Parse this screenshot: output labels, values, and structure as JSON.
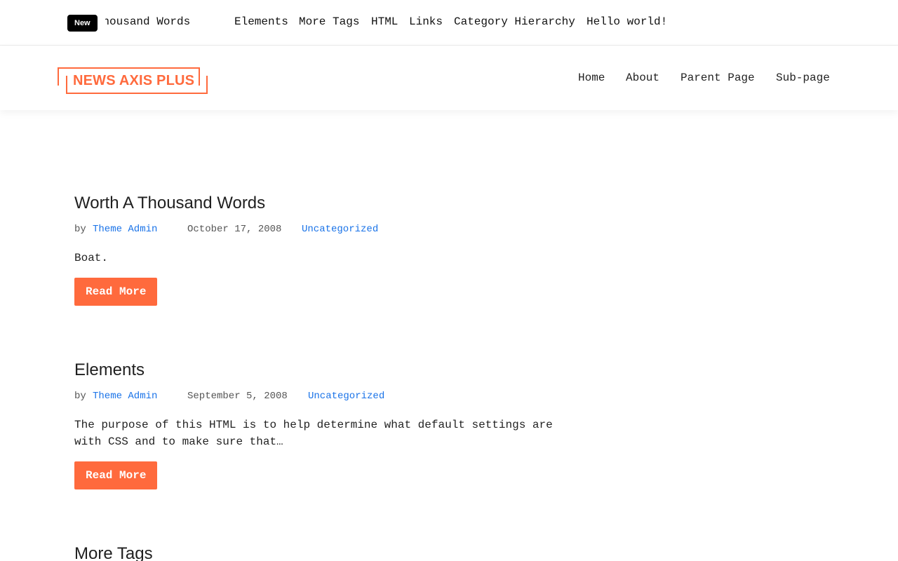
{
  "ticker": {
    "badge": "New",
    "items": [
      "Worth A Thousand Words",
      "Elements",
      "More Tags",
      "HTML",
      "Links",
      "Category Hierarchy",
      "Hello world!"
    ]
  },
  "header": {
    "logo_text": "NEWS AXIS PLUS",
    "nav": [
      "Home",
      "About",
      "Parent Page",
      "Sub-page"
    ]
  },
  "accent_color": "#ff6a3d",
  "link_color": "#1a73e8",
  "posts": [
    {
      "title": "Worth A Thousand Words",
      "by": "by",
      "author": "Theme Admin",
      "date": "October 17, 2008",
      "category": "Uncategorized",
      "excerpt": "Boat.",
      "read_more": "Read More"
    },
    {
      "title": "Elements",
      "by": "by",
      "author": "Theme Admin",
      "date": "September 5, 2008",
      "category": "Uncategorized",
      "excerpt": "The purpose of this HTML is to help determine what default settings are with CSS and to make sure that…",
      "read_more": "Read More"
    },
    {
      "title": "More Tags"
    }
  ]
}
